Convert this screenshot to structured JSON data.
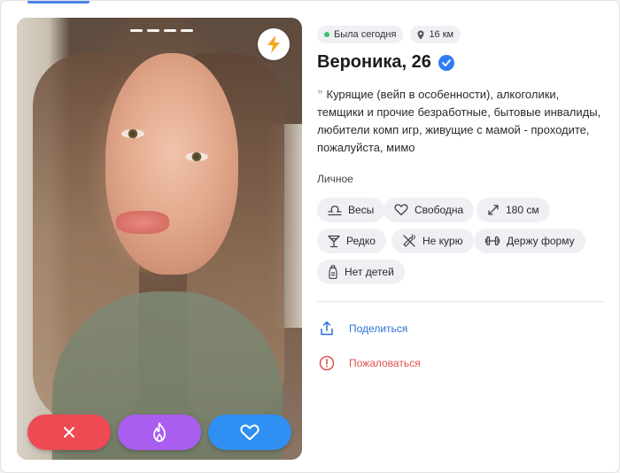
{
  "profile": {
    "status": "Была сегодня",
    "distance": "16 км",
    "name_age": "Вероника, 26",
    "bio_quote": "”",
    "bio": "Курящие (вейп в особенности), алкоголики, темщики и прочие безработные, бытовые инвалиды, любители комп игр, живущие с мамой - проходите, пожалуйста, мимо"
  },
  "personal": {
    "label": "Личное",
    "chips": [
      {
        "icon": "libra-icon",
        "text": "Весы"
      },
      {
        "icon": "heart-outline-icon",
        "text": "Свободна"
      },
      {
        "icon": "height-arrows-icon",
        "text": "180 см"
      },
      {
        "icon": "cocktail-glass-icon",
        "text": "Редко"
      },
      {
        "icon": "no-smoking-icon",
        "text": "Не курю"
      },
      {
        "icon": "dumbbell-icon",
        "text": "Держу форму"
      },
      {
        "icon": "baby-bottle-icon",
        "text": "Нет детей"
      }
    ]
  },
  "actions": {
    "share": "Поделиться",
    "report": "Пожаловаться"
  },
  "colors": {
    "dislike": "#ee4a53",
    "superlike": "#a95ef0",
    "like": "#2f8ff2",
    "verified": "#2f7df6",
    "online": "#35c46a",
    "share": "#2b6fd6",
    "report": "#e0504f",
    "boost": "#f5a623"
  }
}
